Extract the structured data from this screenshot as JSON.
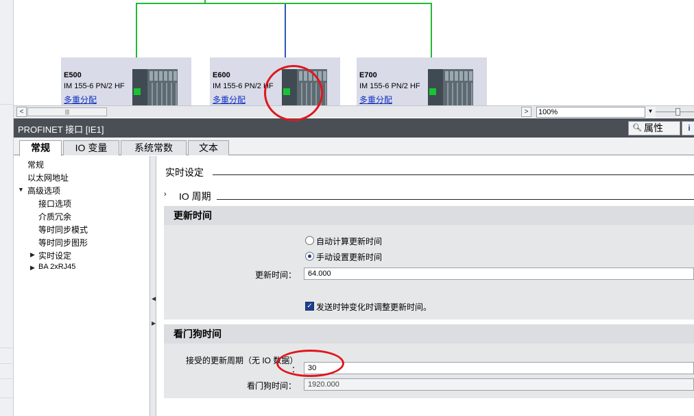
{
  "network": {
    "devices": [
      {
        "name": "E500",
        "type": "IM 155-6 PN/2 HF",
        "link": "多重分配"
      },
      {
        "name": "E600",
        "type": "IM 155-6 PN/2 HF",
        "link": "多重分配"
      },
      {
        "name": "E700",
        "type": "IM 155-6 PN/2 HF",
        "link": "多重分配"
      }
    ],
    "wire_colors": {
      "profinet": "#22b833",
      "subnet": "#2a55b8"
    },
    "scroll_thumb_glyph": "|||",
    "zoom": "100%"
  },
  "inspector": {
    "title": "PROFINET 接口 [IE1]",
    "properties_button": "属性",
    "properties_icon": "search-window-icon",
    "info_glyph": "i"
  },
  "tabs": [
    "常规",
    "IO 变量",
    "系统常数",
    "文本"
  ],
  "active_tab": "常规",
  "tree": [
    {
      "label": "常规",
      "level": 0,
      "arrow": ""
    },
    {
      "label": "以太网地址",
      "level": 0,
      "arrow": ""
    },
    {
      "label": "高级选项",
      "level": 0,
      "arrow": "▼"
    },
    {
      "label": "接口选项",
      "level": 1,
      "arrow": ""
    },
    {
      "label": "介质冗余",
      "level": 1,
      "arrow": ""
    },
    {
      "label": "等时同步模式",
      "level": 1,
      "arrow": ""
    },
    {
      "label": "等时同步图形",
      "level": 1,
      "arrow": ""
    },
    {
      "label": "实时设定",
      "level": 1,
      "arrow": "▶"
    },
    {
      "label": "BA 2xRJ45",
      "level": 1,
      "arrow": "▶"
    }
  ],
  "main": {
    "section_title": "实时设定",
    "subsection_title": "IO 周期",
    "subsection_arrow": "›",
    "update_time": {
      "header": "更新时间",
      "radio_auto": "自动计算更新时间",
      "radio_manual": "手动设置更新时间",
      "field_label": "更新时间：",
      "field_value": "64.000",
      "checkbox_label": "发送时钟变化时调整更新时间。",
      "checkbox_checked": true
    },
    "watchdog": {
      "header": "看门狗时间",
      "accepted_label": "接受的更新周期（无 IO 数据）",
      "colon": "：",
      "accepted_value": "30",
      "watchdog_label": "看门狗时间：",
      "watchdog_value": "1920.000"
    }
  },
  "annotation_color": "#e0161d"
}
